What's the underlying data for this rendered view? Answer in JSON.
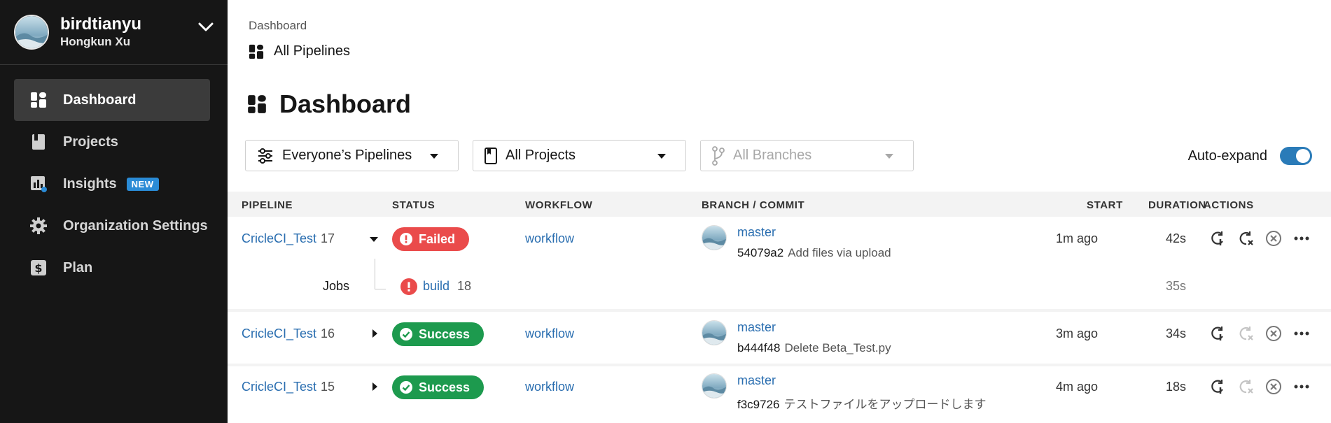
{
  "sidebar": {
    "org_name": "birdtianyu",
    "user_name": "Hongkun Xu",
    "items": [
      {
        "label": "Dashboard",
        "icon": "dashboard-icon",
        "active": true
      },
      {
        "label": "Projects",
        "icon": "book-icon"
      },
      {
        "label": "Insights",
        "icon": "insights-icon",
        "badge": "NEW"
      },
      {
        "label": "Organization Settings",
        "icon": "gear-icon"
      },
      {
        "label": "Plan",
        "icon": "dollar-icon"
      }
    ]
  },
  "breadcrumb": {
    "parent": "Dashboard",
    "current": "All Pipelines"
  },
  "page_title": "Dashboard",
  "filters": {
    "pipelines": "Everyone’s Pipelines",
    "projects": "All Projects",
    "branches": "All Branches"
  },
  "auto_expand": {
    "label": "Auto-expand",
    "on": true
  },
  "colors": {
    "accent": "#2a6eb0",
    "failed": "#ea4b4b",
    "success": "#1d9a4e",
    "sidebar_bg": "#161616",
    "toggle": "#2a7bb8"
  },
  "table": {
    "headers": {
      "pipeline": "PIPELINE",
      "status": "STATUS",
      "workflow": "WORKFLOW",
      "branch_commit": "BRANCH / COMMIT",
      "start": "START",
      "duration": "DURATION",
      "actions": "ACTIONS"
    },
    "rows": [
      {
        "project": "CricleCI_Test",
        "number": "17",
        "status": "Failed",
        "workflow": "workflow",
        "branch": "master",
        "sha": "54079a2",
        "message": "Add files via upload",
        "start": "1m ago",
        "duration": "42s",
        "expanded": true
      },
      {
        "project": "CricleCI_Test",
        "number": "16",
        "status": "Success",
        "workflow": "workflow",
        "branch": "master",
        "sha": "b444f48",
        "message": "Delete Beta_Test.py",
        "start": "3m ago",
        "duration": "34s"
      },
      {
        "project": "CricleCI_Test",
        "number": "15",
        "status": "Success",
        "workflow": "workflow",
        "branch": "master",
        "sha": "f3c9726",
        "message": "テストファイルをアップロードします",
        "start": "4m ago",
        "duration": "18s"
      }
    ],
    "jobs": {
      "label": "Jobs",
      "name": "build",
      "number": "18",
      "duration": "35s"
    }
  }
}
